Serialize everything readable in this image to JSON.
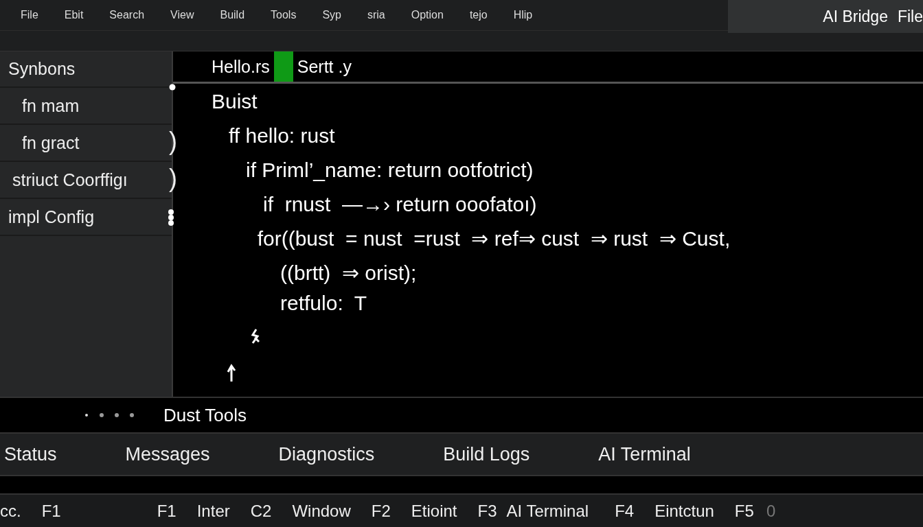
{
  "menu": [
    "File",
    "Ebit",
    "Search",
    "View",
    "Build",
    "Tools",
    "Syp",
    "sria",
    "Option",
    "tejo",
    "Hlip"
  ],
  "bridge_panel": {
    "title": "AI Bridge",
    "menu": "File"
  },
  "sidebar": {
    "title": "Synbons",
    "items": [
      {
        "label": "fn mam",
        "marker": ""
      },
      {
        "label": "fn gract",
        "marker": ")"
      },
      {
        "label": "striuct Coorffigı",
        "marker": ")"
      },
      {
        "label": "impl Config",
        "marker": "",
        "more": true
      }
    ]
  },
  "editor": {
    "tabs": [
      "Hello.rs",
      "Sertt .y"
    ],
    "lines": [
      "Buist",
      "   ff hello: rust",
      "      if Priml’_name: return ootfotrict)",
      "         if  rnust  —→› return ooofatoı)",
      "        for((bust  = nust  =rust  ⇒ ref⇒ cust  ⇒ rust  ⇒ Cust,",
      "            ((brtt)  ⇒ orist);",
      "            retfulo:  T"
    ]
  },
  "tools_bar": {
    "title": "Dust Tools"
  },
  "panel_tabs": [
    "Status",
    "Messages",
    "Diagnostics",
    "Build Logs",
    "AI Terminal"
  ],
  "function_keys": [
    "cc.",
    "F1",
    "F1",
    "Inter",
    "C2",
    "Window",
    "F2",
    "Etioint",
    "F3",
    "AI Terminal",
    "F4",
    "Eintctun",
    "F5",
    "0"
  ]
}
